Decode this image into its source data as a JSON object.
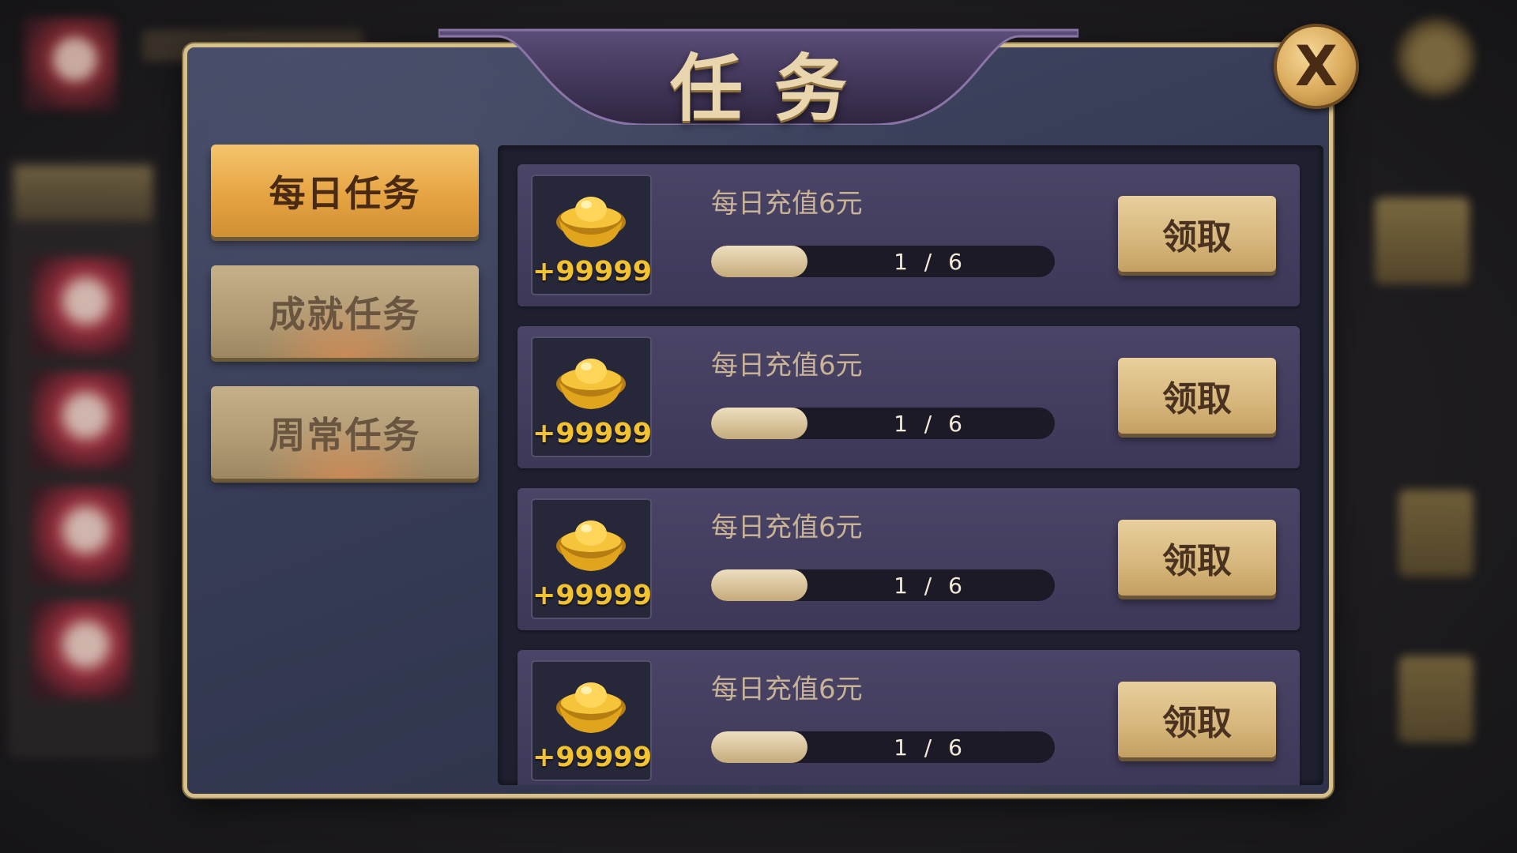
{
  "dialog": {
    "title": "任务",
    "close_label": "X"
  },
  "tabs": [
    {
      "label": "每日任务",
      "active": true
    },
    {
      "label": "成就任务",
      "active": false
    },
    {
      "label": "周常任务",
      "active": false
    }
  ],
  "tasks": [
    {
      "reward": "+99999",
      "title": "每日充值6元",
      "progress_text": "1 / 6",
      "progress": 0.28,
      "button": "领取"
    },
    {
      "reward": "+99999",
      "title": "每日充值6元",
      "progress_text": "1 / 6",
      "progress": 0.28,
      "button": "领取"
    },
    {
      "reward": "+99999",
      "title": "每日充值6元",
      "progress_text": "1 / 6",
      "progress": 0.28,
      "button": "领取"
    },
    {
      "reward": "+99999",
      "title": "每日充值6元",
      "progress_text": "1 / 6",
      "progress": 0.28,
      "button": "领取"
    }
  ],
  "icons": {
    "reward": "gold-ingot-icon",
    "close": "close-icon"
  },
  "colors": {
    "accent_gold": "#e6a443",
    "reward_text": "#f2c230",
    "panel_bg": "#363b55"
  }
}
